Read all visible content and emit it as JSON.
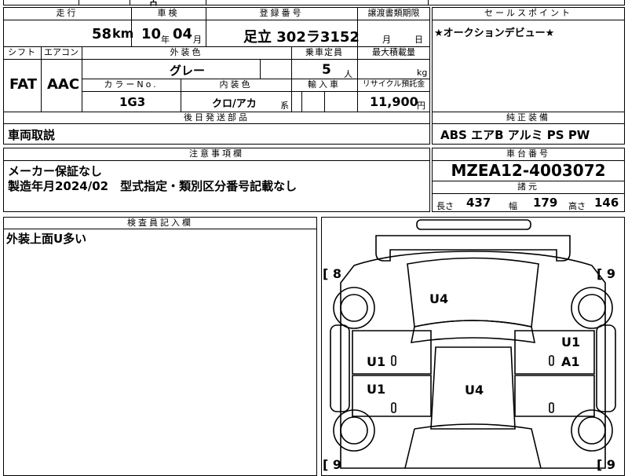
{
  "top_strip": {
    "partial_text": "古"
  },
  "summary": {
    "mileage": {
      "header": "走行",
      "value": "58",
      "unit": "km"
    },
    "inspection": {
      "header": "車検",
      "year": "10",
      "year_unit": "年",
      "month": "04",
      "month_unit": "月"
    },
    "registration": {
      "header": "登録番号",
      "value": "足立 302ラ3152"
    },
    "transfer_docs": {
      "header": "譲渡書類期限",
      "month_unit": "月",
      "day_unit": "日"
    },
    "sales_point": {
      "header": "セールスポイント",
      "text": "★オークションデビュー★"
    }
  },
  "specs": {
    "shift": {
      "header": "シフト",
      "value": "FAT"
    },
    "aircon": {
      "header": "エアコン",
      "value": "AAC"
    },
    "exterior_color": {
      "header": "外装色",
      "value": "グレー"
    },
    "capacity": {
      "header": "乗車定員",
      "value": "5",
      "unit": "人"
    },
    "max_load": {
      "header": "最大積載量",
      "unit": "kg"
    },
    "color_no": {
      "header": "カラーNo.",
      "value": "1G3"
    },
    "interior_color": {
      "header": "内装色",
      "value": "クロ/アカ",
      "suffix": "系"
    },
    "import": {
      "header": "輸入車"
    },
    "recycle": {
      "header": "リサイクル預託金",
      "value": "11,900",
      "unit": "円"
    }
  },
  "later_parts": {
    "header": "後日発送部品",
    "value": "車両取説"
  },
  "genuine_equipment": {
    "header": "純正装備",
    "value": "ABS エアB アルミ PS PW"
  },
  "notes": {
    "header": "注意事項欄",
    "lines": [
      "メーカー保証なし",
      "製造年月2024/02　型式指定・類別区分番号記載なし"
    ]
  },
  "chassis": {
    "header": "車台番号",
    "value": "MZEA12-4003072"
  },
  "dimensions": {
    "header": "諸元",
    "length_label": "長さ",
    "length": "437",
    "width_label": "幅",
    "width": "179",
    "height_label": "高さ",
    "height": "146"
  },
  "inspector": {
    "header": "検査員記入欄",
    "text": "外装上面U多い"
  },
  "diagram": {
    "tire_fl": "[ 8",
    "tire_fr": "[ 9",
    "tire_rl": "[ 9",
    "tire_rr": "[ 9",
    "hood": "U4",
    "left_front_door": "U1",
    "left_rear_door": "U1",
    "roof": "U4",
    "right_front_door_1": "U1",
    "right_front_door_2": "A1"
  }
}
